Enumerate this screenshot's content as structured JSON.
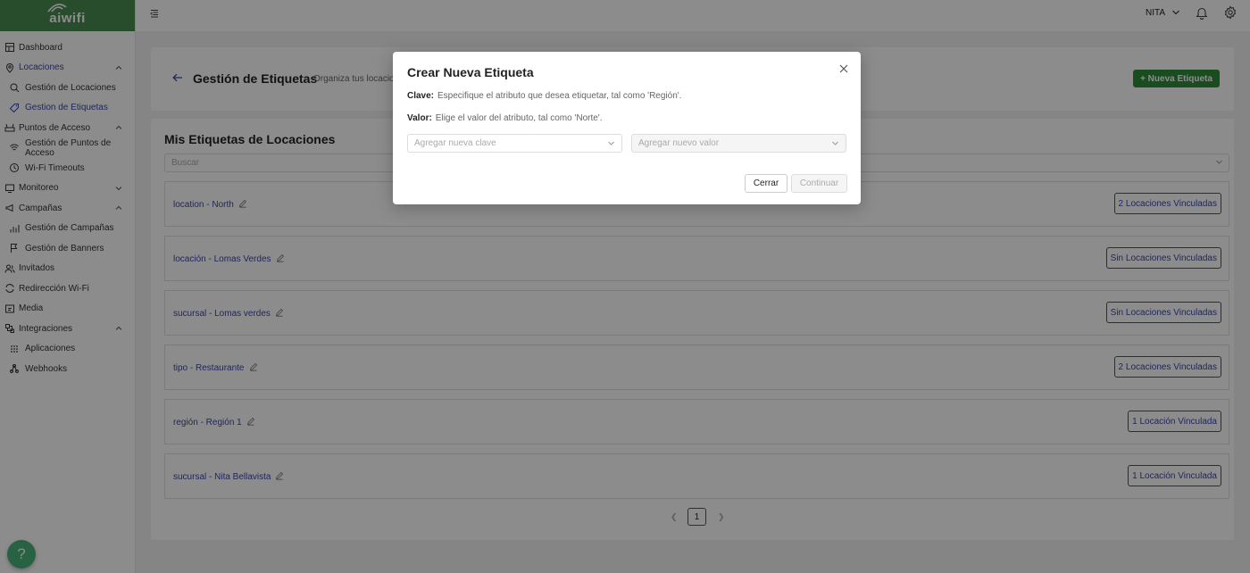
{
  "brand": {
    "logo_text": "aiwifi",
    "color": "#4a8c52"
  },
  "topbar": {
    "user_name": "NITA"
  },
  "sidebar": {
    "items": [
      {
        "label": "Dashboard",
        "icon": "dashboard-icon",
        "type": "top"
      },
      {
        "label": "Locaciones",
        "icon": "map-pin-icon",
        "type": "parent",
        "expanded": true
      },
      {
        "label": "Gestión de Locaciones",
        "icon": "map-search-icon",
        "type": "sub"
      },
      {
        "label": "Gestion de Etiquetas",
        "icon": "tag-icon",
        "type": "sub",
        "selected": true
      },
      {
        "label": "Puntos de Acceso",
        "icon": "router-icon",
        "type": "parent",
        "expanded": true
      },
      {
        "label": "Gestión de Puntos de Acceso",
        "icon": "wifi-signal-icon",
        "type": "sub"
      },
      {
        "label": "Wi-Fi Timeouts",
        "icon": "clock-icon",
        "type": "sub"
      },
      {
        "label": "Monitoreo",
        "icon": "monitor-icon",
        "type": "parent",
        "expanded": false
      },
      {
        "label": "Campañas",
        "icon": "megaphone-icon",
        "type": "parent",
        "expanded": true
      },
      {
        "label": "Gestión de Campañas",
        "icon": "bar-chart-icon",
        "type": "sub"
      },
      {
        "label": "Gestión de Banners",
        "icon": "flag-icon",
        "type": "sub"
      },
      {
        "label": "Invitados",
        "icon": "users-icon",
        "type": "top"
      },
      {
        "label": "Redirección Wi-Fi",
        "icon": "redirect-icon",
        "type": "top"
      },
      {
        "label": "Media",
        "icon": "media-icon",
        "type": "top"
      },
      {
        "label": "Integraciones",
        "icon": "integrations-icon",
        "type": "parent",
        "expanded": true
      },
      {
        "label": "Aplicaciones",
        "icon": "apps-grid-icon",
        "type": "sub"
      },
      {
        "label": "Webhooks",
        "icon": "webhook-icon",
        "type": "sub"
      }
    ]
  },
  "header": {
    "title": "Gestión de Etiquetas",
    "subtitle": "Organiza tus locacio",
    "new_button": "+ Nueva Etiqueta"
  },
  "list": {
    "title": "Mis Etiquetas de Locaciones",
    "search_placeholder": "Buscar",
    "rows": [
      {
        "label": "location - North",
        "badge": "2 Locaciones Vinculadas"
      },
      {
        "label": "locación - Lomas Verdes",
        "badge": "Sin Locaciones Vinculadas"
      },
      {
        "label": "sucursal - Lomas verdes",
        "badge": "Sin Locaciones Vinculadas"
      },
      {
        "label": "tipo - Restaurante",
        "badge": "2 Locaciones Vinculadas"
      },
      {
        "label": "región - Región 1",
        "badge": "1 Locación Vinculada"
      },
      {
        "label": "sucursal - Nita Bellavista",
        "badge": "1 Locación Vinculada"
      }
    ],
    "pagination": {
      "current_page": "1"
    }
  },
  "modal": {
    "title": "Crear Nueva Etiqueta",
    "clave_label": "Clave:",
    "clave_text": "Especifique el atributo que desea etiquetar, tal como 'Región'.",
    "valor_label": "Valor:",
    "valor_text": "Elige el valor del atributo, tal como 'Norte'.",
    "key_placeholder": "Agregar nueva clave",
    "value_placeholder": "Agregar nuevo valor",
    "cancel_label": "Cerrar",
    "continue_label": "Continuar"
  }
}
